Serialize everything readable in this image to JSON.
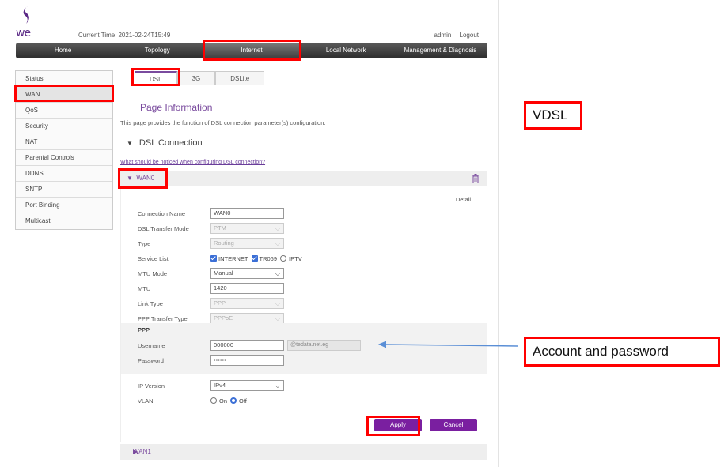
{
  "header": {
    "logo_text": "we",
    "time_label": "Current Time:",
    "time_value": "2021-02-24T15:49",
    "user": "admin",
    "logout": "Logout"
  },
  "nav": [
    "Home",
    "Topology",
    "Internet",
    "Local Network",
    "Management & Diagnosis"
  ],
  "nav_active": "Internet",
  "sidebar": [
    "Status",
    "WAN",
    "QoS",
    "Security",
    "NAT",
    "Parental Controls",
    "DDNS",
    "SNTP",
    "Port Binding",
    "Multicast"
  ],
  "sidebar_active": "WAN",
  "tabs": [
    "DSL",
    "3G",
    "DSLite"
  ],
  "tab_active": "DSL",
  "page": {
    "title": "Page Information",
    "description": "This page provides the function of DSL connection parameter(s) configuration.",
    "section": "DSL Connection",
    "notice_link": "What should be noticed when configuring DSL connection?"
  },
  "wan0": {
    "title": "WAN0",
    "detail": "Detail",
    "connection_name": {
      "label": "Connection Name",
      "value": "WAN0"
    },
    "dsl_transfer_mode": {
      "label": "DSL Transfer Mode",
      "value": "PTM"
    },
    "type": {
      "label": "Type",
      "value": "Routing"
    },
    "service_list": {
      "label": "Service List",
      "options": [
        {
          "name": "INTERNET",
          "checked": true
        },
        {
          "name": "TR069",
          "checked": true
        },
        {
          "name": "IPTV",
          "checked": false
        }
      ]
    },
    "mtu_mode": {
      "label": "MTU Mode",
      "value": "Manual"
    },
    "mtu": {
      "label": "MTU",
      "value": "1420"
    },
    "link_type": {
      "label": "Link Type",
      "value": "PPP"
    },
    "ppp_transfer_type": {
      "label": "PPP Transfer Type",
      "value": "PPPoE"
    },
    "ppp": {
      "title": "PPP",
      "username": {
        "label": "Username",
        "value": "000000",
        "suffix": "@tedata.net.eg"
      },
      "password": {
        "label": "Password",
        "value": "••••••"
      }
    },
    "ip_version": {
      "label": "IP Version",
      "value": "IPv4"
    },
    "vlan": {
      "label": "VLAN",
      "on": "On",
      "off": "Off",
      "selected": "Off"
    },
    "apply": "Apply",
    "cancel": "Cancel"
  },
  "wan1": {
    "title": "WAN1"
  },
  "annotations": {
    "vdsl": "VDSL",
    "account": "Account and password",
    "highlight_color": "#ff0000",
    "arrow_color": "#5b8fd6"
  }
}
